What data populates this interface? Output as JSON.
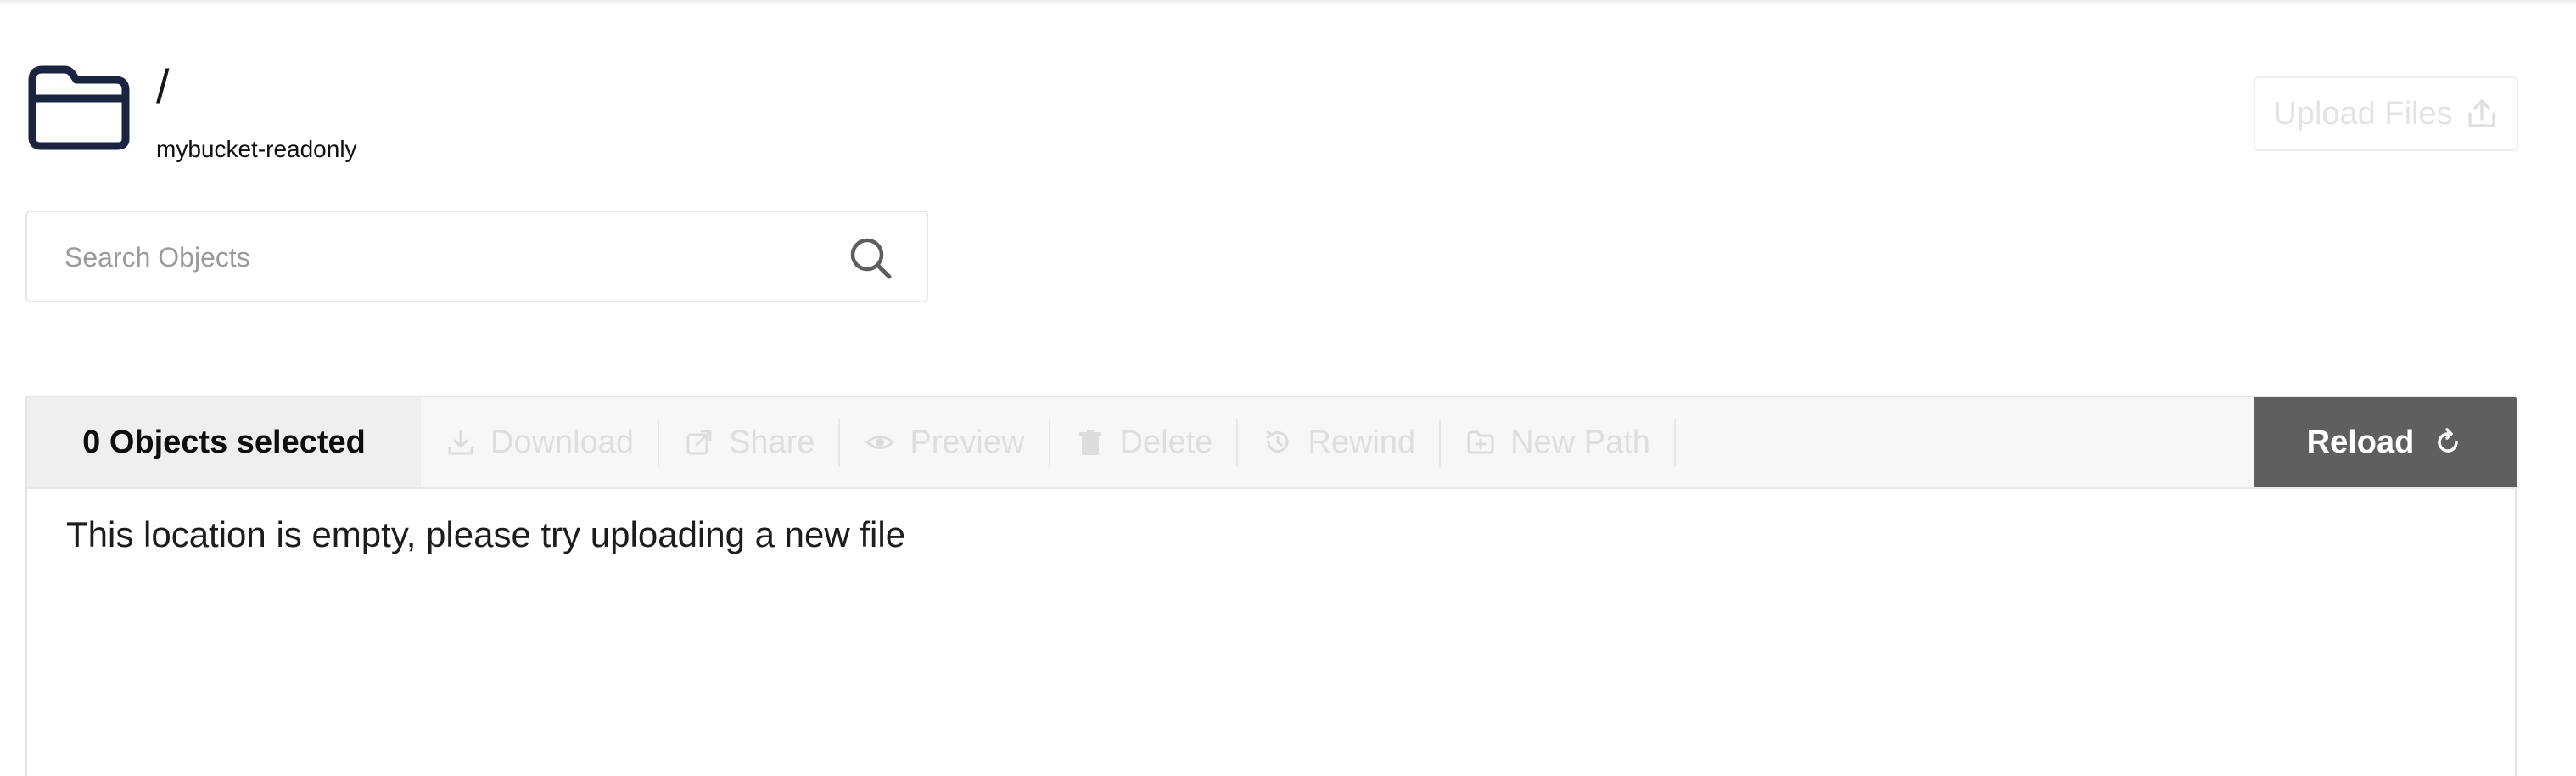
{
  "header": {
    "folder_icon": "folder-icon",
    "path": "/",
    "bucket": "mybucket-readonly",
    "upload_label": "Upload Files",
    "upload_icon": "upload-icon"
  },
  "search": {
    "placeholder": "Search Objects",
    "value": "",
    "icon": "search-icon"
  },
  "toolbar": {
    "selected_label": "0 Objects selected",
    "actions": [
      {
        "label": "Download",
        "icon": "download-icon"
      },
      {
        "label": "Share",
        "icon": "share-icon"
      },
      {
        "label": "Preview",
        "icon": "eye-icon"
      },
      {
        "label": "Delete",
        "icon": "trash-icon"
      },
      {
        "label": "Rewind",
        "icon": "rewind-icon"
      },
      {
        "label": "New Path",
        "icon": "new-folder-icon"
      }
    ],
    "reload_label": "Reload",
    "reload_icon": "refresh-icon"
  },
  "content": {
    "empty_message": "This location is empty, please try uploading a new file"
  },
  "colors": {
    "reload_bg": "#5f5f5f",
    "folder_icon": "#1a2340",
    "disabled_text": "#dedede"
  }
}
